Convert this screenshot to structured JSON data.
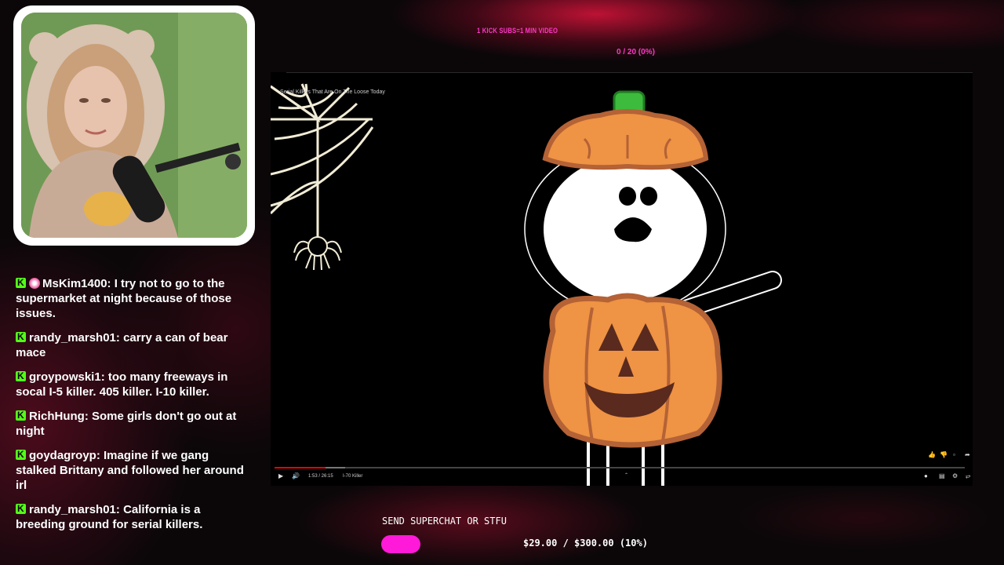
{
  "overlay": {
    "top_banner": "1 KICK SUBS=1 MIN VIDEO",
    "goal_progress": "0 / 20 (0%)"
  },
  "chat": {
    "messages": [
      {
        "user": "MsKim1400",
        "text": "I try not to go to the supermarket at night because of those issues.",
        "has_badge": true
      },
      {
        "user": "randy_marsh01",
        "text": "carry a can of bear mace",
        "has_badge": false
      },
      {
        "user": "groypowski1",
        "text": "too many freeways in socal I-5 killer. 405 killer. I-10 killer.",
        "has_badge": false
      },
      {
        "user": "RichHung",
        "text": "Some girls don't go out at night",
        "has_badge": false
      },
      {
        "user": "goydagroyp",
        "text": "Imagine if we gang stalked Brittany and followed her around irl",
        "has_badge": false
      },
      {
        "user": "randy_marsh01",
        "text": "California is a breeding ground for serial killers.",
        "has_badge": false
      }
    ]
  },
  "player": {
    "video_title": "Serial Killers That Are On The Loose Today",
    "time_display": "1:53 / 26:15",
    "chapter": "I-70 Killer",
    "progress": 0.074
  },
  "superchat": {
    "label": "SEND SUPERCHAT OR STFU",
    "amount": "$29.00 / $300.00 (10%)",
    "progress": 0.1
  },
  "colors": {
    "accent_pink": "#ff38c8",
    "kick_green": "#53fc18",
    "superchat_pink": "#ff1ad9",
    "progress_red": "#e00000"
  }
}
